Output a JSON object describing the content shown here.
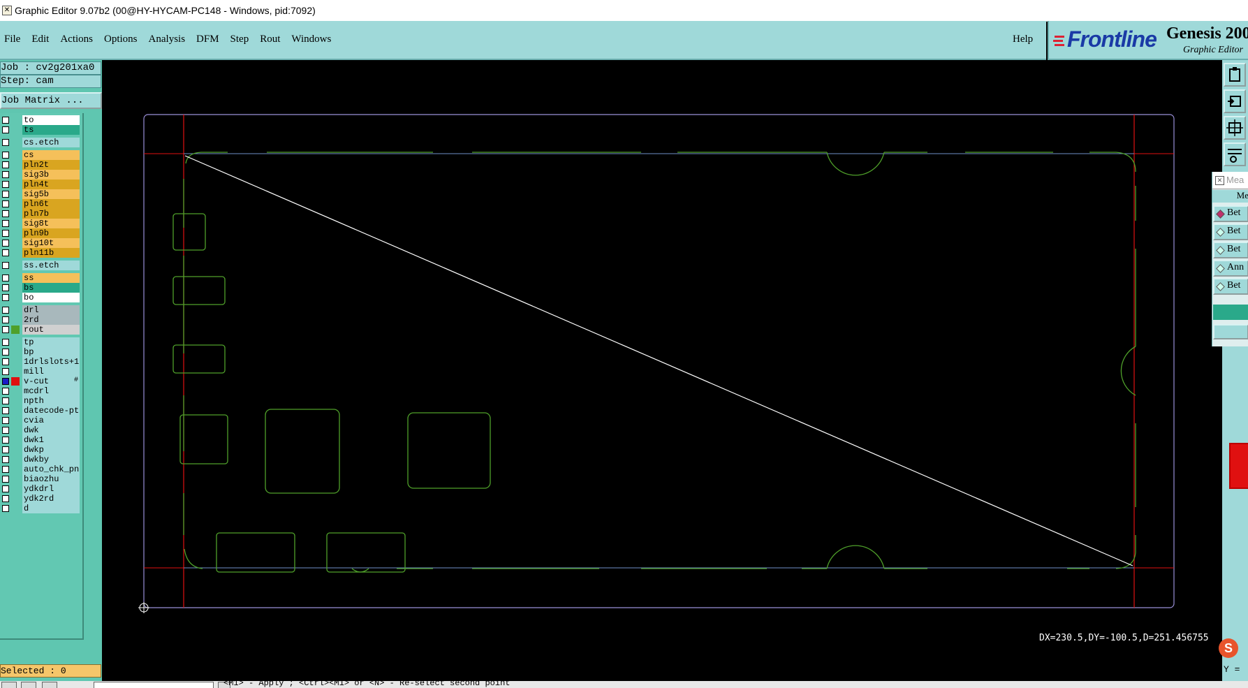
{
  "window": {
    "title": "Graphic Editor 9.07b2 (00@HY-HYCAM-PC148 - Windows, pid:7092)"
  },
  "menubar": {
    "items": [
      "File",
      "Edit",
      "Actions",
      "Options",
      "Analysis",
      "DFM",
      "Step",
      "Rout",
      "Windows"
    ],
    "help": "Help"
  },
  "logo": {
    "brand": "Frontline",
    "product": "Genesis 200",
    "subtitle": "Graphic Editor"
  },
  "leftpanel": {
    "job": "Job : cv2g201xa0",
    "step": "Step: cam",
    "job_matrix": "Job Matrix ...",
    "selected": "Selected : 0"
  },
  "layers": [
    {
      "name": "to",
      "color": "#ffffff",
      "checked": false
    },
    {
      "name": "ts",
      "color": "#2aa98a",
      "checked": false
    },
    {
      "name": "cs.etch",
      "color": "#9fd9d9",
      "checked": false
    },
    {
      "name": "cs",
      "color": "#f5c05a",
      "checked": false
    },
    {
      "name": "pln2t",
      "color": "#d9a520",
      "checked": false
    },
    {
      "name": "sig3b",
      "color": "#f5c05a",
      "checked": false
    },
    {
      "name": "pln4t",
      "color": "#d9a520",
      "checked": false
    },
    {
      "name": "sig5b",
      "color": "#f5c05a",
      "checked": false
    },
    {
      "name": "pln6t",
      "color": "#d9a520",
      "checked": false
    },
    {
      "name": "pln7b",
      "color": "#d9a520",
      "checked": false
    },
    {
      "name": "sig8t",
      "color": "#f5c05a",
      "checked": false
    },
    {
      "name": "pln9b",
      "color": "#d9a520",
      "checked": false
    },
    {
      "name": "sig10t",
      "color": "#f5c05a",
      "checked": false
    },
    {
      "name": "pln11b",
      "color": "#d9a520",
      "checked": false
    },
    {
      "name": "ss.etch",
      "color": "#9fd9d9",
      "checked": false
    },
    {
      "name": "ss",
      "color": "#f5c05a",
      "checked": false
    },
    {
      "name": "bs",
      "color": "#2aa98a",
      "checked": false
    },
    {
      "name": "bo",
      "color": "#ffffff",
      "checked": false
    },
    {
      "name": "drl",
      "color": "#a8b8bc",
      "checked": false
    },
    {
      "name": "2rd",
      "color": "#a8b8bc",
      "checked": false
    },
    {
      "name": "rout",
      "color": "#d0d0d0",
      "checked": false,
      "swatch": "#4fa02a"
    },
    {
      "name": "tp",
      "color": "#9fd9d9",
      "checked": false
    },
    {
      "name": "bp",
      "color": "#9fd9d9",
      "checked": false
    },
    {
      "name": "1drlslots+1",
      "color": "#9fd9d9",
      "checked": false
    },
    {
      "name": "mill",
      "color": "#9fd9d9",
      "checked": false
    },
    {
      "name": "v-cut",
      "color": "#9fd9d9",
      "checked": true,
      "swatch": "#e01010",
      "suffix": "#"
    },
    {
      "name": "mcdrl",
      "color": "#9fd9d9",
      "checked": false
    },
    {
      "name": "npth",
      "color": "#9fd9d9",
      "checked": false
    },
    {
      "name": "datecode-pte",
      "color": "#9fd9d9",
      "checked": false
    },
    {
      "name": "cvia",
      "color": "#9fd9d9",
      "checked": false
    },
    {
      "name": "dwk",
      "color": "#9fd9d9",
      "checked": false
    },
    {
      "name": "dwk1",
      "color": "#9fd9d9",
      "checked": false
    },
    {
      "name": "dwkp",
      "color": "#9fd9d9",
      "checked": false
    },
    {
      "name": "dwkby",
      "color": "#9fd9d9",
      "checked": false
    },
    {
      "name": "auto_chk_pn",
      "color": "#9fd9d9",
      "checked": false
    },
    {
      "name": "biaozhu",
      "color": "#9fd9d9",
      "checked": false
    },
    {
      "name": "ydkdrl",
      "color": "#9fd9d9",
      "checked": false
    },
    {
      "name": "ydk2rd",
      "color": "#9fd9d9",
      "checked": false
    },
    {
      "name": "d",
      "color": "#9fd9d9",
      "checked": false
    }
  ],
  "canvas": {
    "measure_text": "DX=230.5,DY=-100.5,D=251.456755"
  },
  "measure_window": {
    "title": "Mea",
    "header": "Me",
    "options": [
      {
        "label": "Bet",
        "selected": true
      },
      {
        "label": "Bet",
        "selected": false
      },
      {
        "label": "Bet",
        "selected": false
      },
      {
        "label": "Ann",
        "selected": false
      },
      {
        "label": "Bet",
        "selected": false
      }
    ]
  },
  "statusbar": {
    "prompt": "<M1> - Apply  ; <Ctrl><M1> or <N> - Re-select second point",
    "y_coord": "Y ="
  },
  "colors": {
    "panel": "#9fd9d9",
    "board_outline": "#4fa02a",
    "profile": "#9a8fd8",
    "vcut": "#e01010",
    "measure_line": "#ffffff"
  },
  "ime": {
    "icon": "S"
  }
}
